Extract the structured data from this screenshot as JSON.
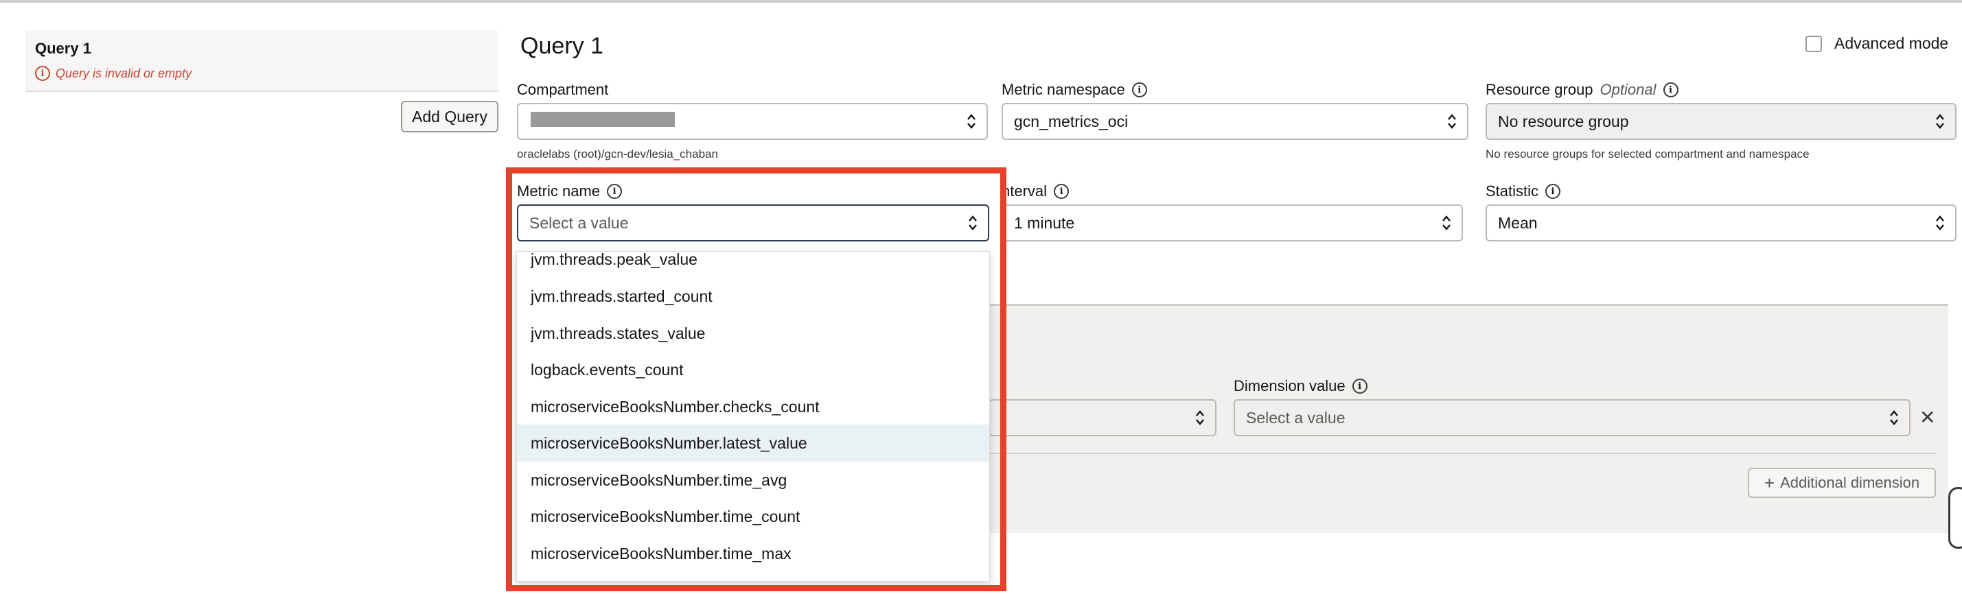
{
  "left_panel": {
    "query_title": "Query 1",
    "query_error": "Query is invalid or empty",
    "add_query_label": "Add Query"
  },
  "main": {
    "title": "Query 1",
    "advanced_mode_label": "Advanced mode"
  },
  "compartment": {
    "label": "Compartment",
    "hint": "oraclelabs (root)/gcn-dev/lesia_chaban"
  },
  "metric_namespace": {
    "label": "Metric namespace",
    "value": "gcn_metrics_oci"
  },
  "resource_group": {
    "label": "Resource group",
    "optional_label": "Optional",
    "value": "No resource group",
    "hint": "No resource groups for selected compartment and namespace"
  },
  "metric_name": {
    "label": "Metric name",
    "placeholder": "Select a value",
    "options": [
      "jvm.threads.peak_value",
      "jvm.threads.started_count",
      "jvm.threads.states_value",
      "logback.events_count",
      "microserviceBooksNumber.checks_count",
      "microserviceBooksNumber.latest_value",
      "microserviceBooksNumber.time_avg",
      "microserviceBooksNumber.time_count",
      "microserviceBooksNumber.time_max"
    ]
  },
  "interval": {
    "label": "nterval",
    "value": "1 minute"
  },
  "statistic": {
    "label": "Statistic",
    "value": "Mean"
  },
  "dimension": {
    "value_label": "Dimension value",
    "value_placeholder": "Select a value",
    "add_label": "Additional dimension"
  },
  "colors": {
    "highlight": "#e5412d",
    "error": "#c74634",
    "hover_row": "#e9f1f5"
  }
}
